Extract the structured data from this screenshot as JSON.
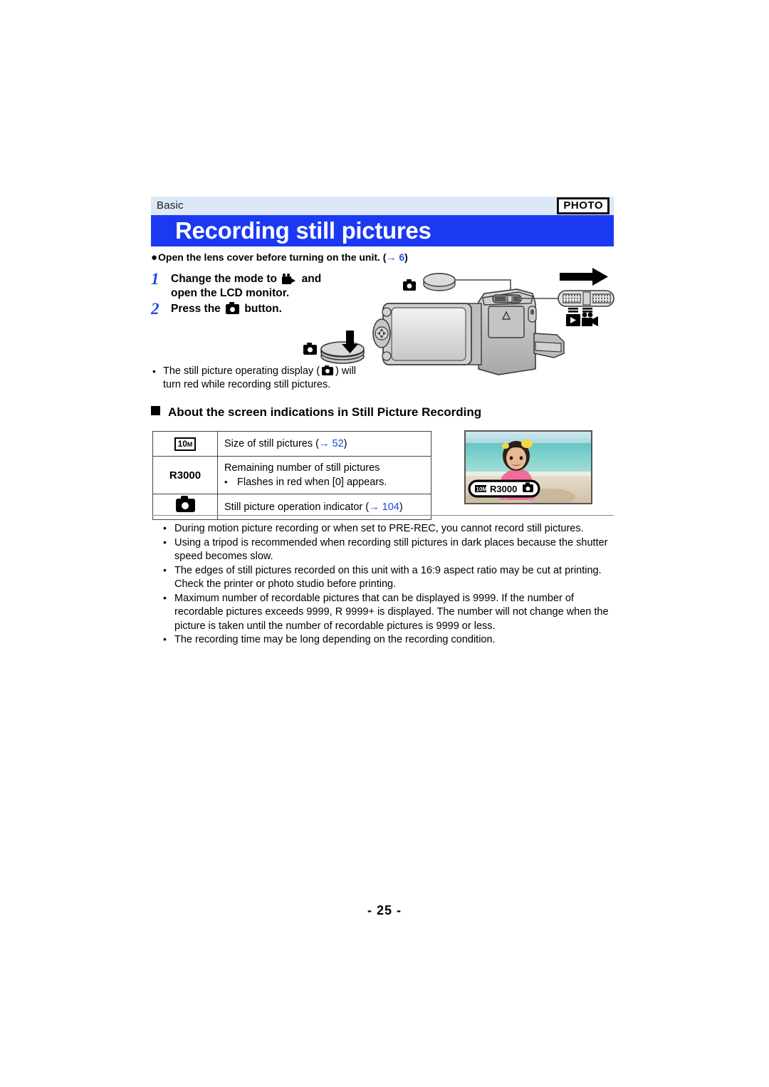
{
  "header": {
    "section_label": "Basic",
    "badge": "PHOTO",
    "title": "Recording still pictures"
  },
  "lead_note": {
    "text_before": "Open the lens cover before turning on the unit. (",
    "arrow": "→",
    "ref": "6",
    "text_after": ")"
  },
  "steps": [
    {
      "number": "1",
      "text_part1": "Change the mode to",
      "icon": "movie-mode-icon",
      "text_part2": "and",
      "text_line2": "open the LCD monitor."
    },
    {
      "number": "2",
      "text_part1": "Press the",
      "icon": "photo-button-icon",
      "text_part2": "button."
    }
  ],
  "sub_note": {
    "bullet": "•",
    "text_part1": "The still picture operating display (",
    "icon": "photo-button-icon",
    "text_part2": ") will",
    "text_line2": "turn red while recording still pictures."
  },
  "section_heading": "About the screen indications in Still Picture Recording",
  "table": {
    "rows": [
      {
        "icon_type": "size-10m-icon",
        "icon_label": "10",
        "icon_sub": "M",
        "desc": "Size of still pictures (",
        "arrow": "→",
        "ref": "52",
        "desc_after": ")"
      },
      {
        "icon_type": "text",
        "icon_label": "R3000",
        "desc": "Remaining number of still pictures",
        "sub_bullet": "•",
        "sub_text": "Flashes in red when [0] appears."
      },
      {
        "icon_type": "photo-indicator-icon",
        "icon_label": "",
        "desc": "Still picture operation indicator (",
        "arrow": "→",
        "ref": "104",
        "desc_after": ")"
      }
    ]
  },
  "thumbnail": {
    "osd_size_label": "10M",
    "osd_remaining": "R3000",
    "osd_photo_icon": "photo-indicator-icon"
  },
  "notes": [
    "During motion picture recording or when set to PRE-REC, you cannot record still pictures.",
    "Using a tripod is recommended when recording still pictures in dark places because the shutter speed becomes slow.",
    "The edges of still pictures recorded on this unit with a 16:9 aspect ratio may be cut at printing. Check the printer or photo studio before printing.",
    "Maximum number of recordable pictures that can be displayed is 9999. If the number of recordable pictures exceeds 9999, R 9999+ is displayed. The number will not change when the picture is taken until the number of recordable pictures is 9999 or less.",
    "The recording time may be long depending on the recording condition."
  ],
  "page_number": "- 25 -",
  "colors": {
    "header_blue": "#1b39f2",
    "header_strip": "#dce8f7",
    "reference_link": "#1a4fd6",
    "step_number": "#2246f0"
  }
}
